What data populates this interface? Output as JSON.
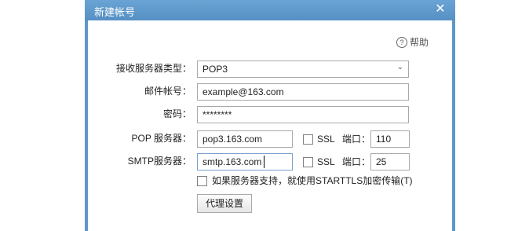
{
  "dialog": {
    "title": "新建帐号",
    "close_glyph": "✕",
    "help_label": "帮助",
    "help_glyph": "?"
  },
  "form": {
    "server_type": {
      "label": "接收服务器类型：",
      "value": "POP3",
      "arrow": "⌄"
    },
    "account": {
      "label": "邮件帐号：",
      "value": "example@163.com"
    },
    "password": {
      "label": "密码：",
      "value": "********"
    },
    "pop_server": {
      "label": "POP 服务器：",
      "value": "pop3.163.com",
      "ssl_label": "SSL",
      "port_label": "端口：",
      "port_value": "110",
      "ssl_checked": false
    },
    "smtp_server": {
      "label": "SMTP服务器：",
      "value": "smtp.163.com",
      "ssl_label": "SSL",
      "port_label": "端口：",
      "port_value": "25",
      "ssl_checked": false
    },
    "starttls": {
      "label": "如果服务器支持，就使用STARTTLS加密传输(T)",
      "checked": false
    },
    "proxy_button": "代理设置"
  },
  "colors": {
    "titlebar": "#5e97c9",
    "title_text": "#ffffff",
    "border": "#a9a9a9"
  }
}
